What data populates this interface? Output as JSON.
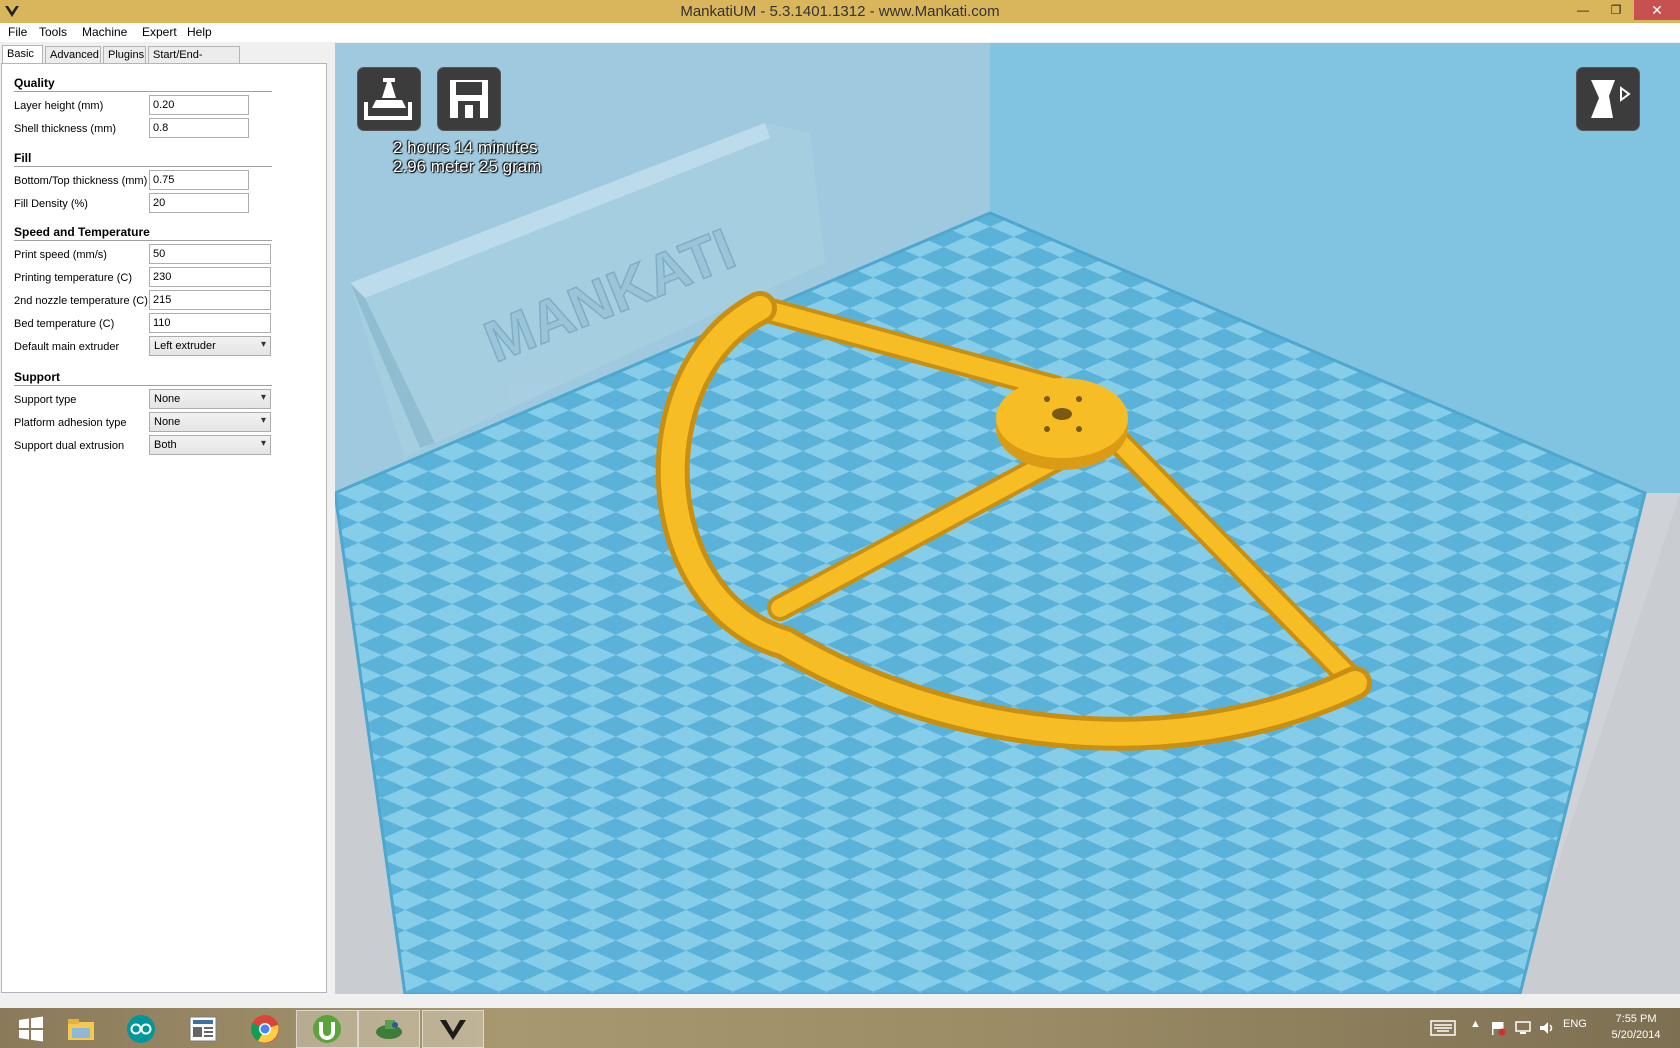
{
  "window": {
    "title": "MankatiUM - 5.3.1401.1312 - www.Mankati.com",
    "minimize_glyph": "—",
    "maximize_glyph": "❐",
    "close_glyph": "✕"
  },
  "menu": {
    "items": [
      "File",
      "Tools",
      "Machine",
      "Expert",
      "Help"
    ]
  },
  "tabs": [
    "Basic",
    "Advanced",
    "Plugins",
    "Start/End-GCode"
  ],
  "settings": {
    "quality": {
      "title": "Quality",
      "layer_height_label": "Layer height (mm)",
      "layer_height_value": "0.20",
      "shell_thickness_label": "Shell thickness (mm)",
      "shell_thickness_value": "0.8"
    },
    "fill": {
      "title": "Fill",
      "bottom_top_label": "Bottom/Top thickness (mm)",
      "bottom_top_value": "0.75",
      "density_label": "Fill Density (%)",
      "density_value": "20"
    },
    "speed": {
      "title": "Speed and Temperature",
      "print_speed_label": "Print speed (mm/s)",
      "print_speed_value": "50",
      "print_temp_label": "Printing temperature (C)",
      "print_temp_value": "230",
      "nozzle2_temp_label": "2nd nozzle temperature (C)",
      "nozzle2_temp_value": "215",
      "bed_temp_label": "Bed temperature (C)",
      "bed_temp_value": "110",
      "extruder_label": "Default main extruder",
      "extruder_value": "Left extruder"
    },
    "support": {
      "title": "Support",
      "type_label": "Support type",
      "type_value": "None",
      "adhesion_label": "Platform adhesion type",
      "adhesion_value": "None",
      "dual_label": "Support dual extrusion",
      "dual_value": "Both"
    }
  },
  "viewport": {
    "print_time": "2 hours 14 minutes",
    "print_material": "2.96 meter 25 gram",
    "back_wall_text": "MANKATI",
    "colors": {
      "bed_light": "#86cde9",
      "bed_dark": "#5ab2d8",
      "wall": "#9fcbe0",
      "model": "#f7bd25"
    }
  },
  "taskbar": {
    "apps": [
      "windows-start",
      "file-explorer",
      "arduino",
      "news-reader",
      "chrome",
      "utorrent",
      "game",
      "mankati"
    ],
    "language": "ENG",
    "time": "7:55 PM",
    "date": "5/20/2014"
  }
}
